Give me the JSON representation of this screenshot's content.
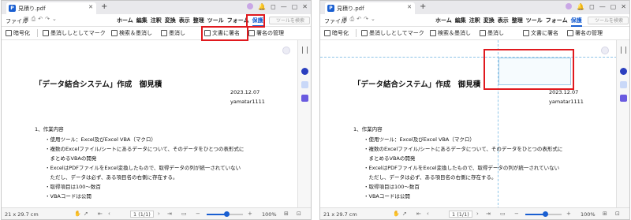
{
  "left": {
    "tab": {
      "title": "見積り.pdf"
    },
    "menu": {
      "file": "ファイル",
      "items": [
        "ホーム",
        "編集",
        "注釈",
        "変換",
        "表示",
        "整理",
        "ツール",
        "フォーム",
        "保護"
      ],
      "active": "保護",
      "search_placeholder": "ツールを検索"
    },
    "toolbar": [
      "暗号化",
      "墨消ししとしてマーク",
      "検索＆墨消し",
      "墨消し",
      "文書に署名",
      "署名の管理"
    ],
    "document": {
      "title": "「データ結合システム」作成　御見積",
      "date": "2023.12.07",
      "author": "yamatar1111",
      "heading": "1、作業内容",
      "bullets": [
        "・使用ツール：Excel及びExcel VBA（マクロ）",
        "・複数のExcelファイル/シートにあるデータについて、そのデータをひとつの表形式に",
        "　まとめるVBAの開発",
        "・ExcelはPDFファイルをExcel変換したもので、取得データの列が統一されていない",
        "　ただし、データは必ず、ある項目名の右側に存在する。",
        "・取得項目は100～数百",
        "・VBAコードは公開"
      ]
    },
    "status": {
      "size": "21 x 29.7 cm",
      "page": "1 (1/1)",
      "zoom": "100%",
      "zoom_fraction": 0.55
    }
  },
  "right": {
    "tab": {
      "title": "見積り.pdf"
    },
    "menu": {
      "file": "ファイル",
      "items": [
        "ホーム",
        "編集",
        "注釈",
        "変換",
        "表示",
        "整理",
        "ツール",
        "フォーム",
        "保護"
      ],
      "active": "保護",
      "search_placeholder": "ツールを検索"
    },
    "toolbar": [
      "暗号化",
      "墨消ししとしてマーク",
      "検索＆墨消し",
      "墨消し",
      "文書に署名",
      "署名の管理"
    ],
    "document": {
      "title": "「データ結合システム」作成　御見積",
      "date": "2023.12.07",
      "author": "yamatar1111",
      "heading": "1、作業内容",
      "bullets": [
        "・使用ツール：Excel及びExcel VBA（マクロ）",
        "・複数のExcelファイル/シートにあるデータについて、そのデータをひとつの表形式に",
        "　まとめるVBAの開発",
        "・ExcelはPDFファイルをExcel変換したもので、取得データの列が統一されていない",
        "　ただし、データは必ず、ある項目名の右側に存在する。",
        "・取得項目は100～数百",
        "・VBAコードは公開"
      ]
    },
    "status": {
      "size": "21 x 29.7 cm",
      "page": "1 (1/1)",
      "zoom": "100%",
      "zoom_fraction": 0.55
    }
  },
  "colors": {
    "accent": "#1a5fd1",
    "highlight": "#e0191e",
    "guide": "#8fc5e8"
  }
}
